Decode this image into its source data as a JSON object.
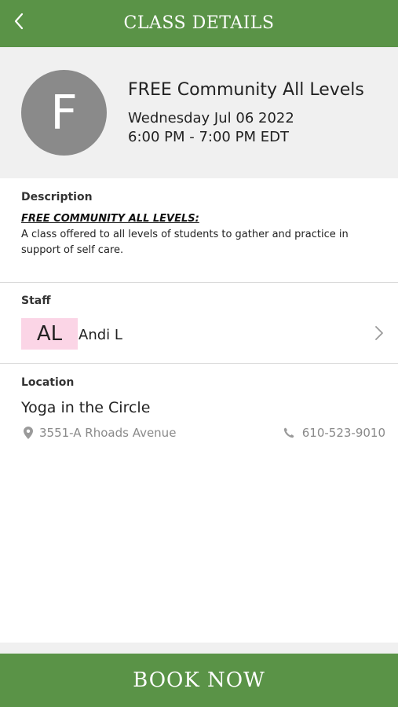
{
  "header": {
    "title": "CLASS DETAILS",
    "back_icon": "chevron-left-icon"
  },
  "class_info": {
    "avatar_letter": "F",
    "name": "FREE Community All Levels",
    "date": "Wednesday Jul 06 2022",
    "time": "6:00 PM - 7:00 PM EDT"
  },
  "description": {
    "label": "Description",
    "heading": "FREE COMMUNITY ALL LEVELS:",
    "body": "A class offered to all levels of students to gather and practice in support of self care."
  },
  "staff": {
    "label": "Staff",
    "initials": "AL",
    "name": "Andi L",
    "chevron_icon": "chevron-right-icon"
  },
  "location": {
    "label": "Location",
    "name": "Yoga in the Circle",
    "address": "3551-A Rhoads Avenue",
    "address_icon": "map-pin-icon",
    "phone": "610-523-9010",
    "phone_icon": "phone-icon"
  },
  "footer": {
    "book_label": "BOOK NOW"
  },
  "colors": {
    "brand_green": "#5a9347",
    "hero_bg": "#f0f0f0",
    "avatar_gray": "#8a8a8a",
    "initials_bg": "#fbd5e6",
    "muted_text": "#8a8a8a"
  }
}
